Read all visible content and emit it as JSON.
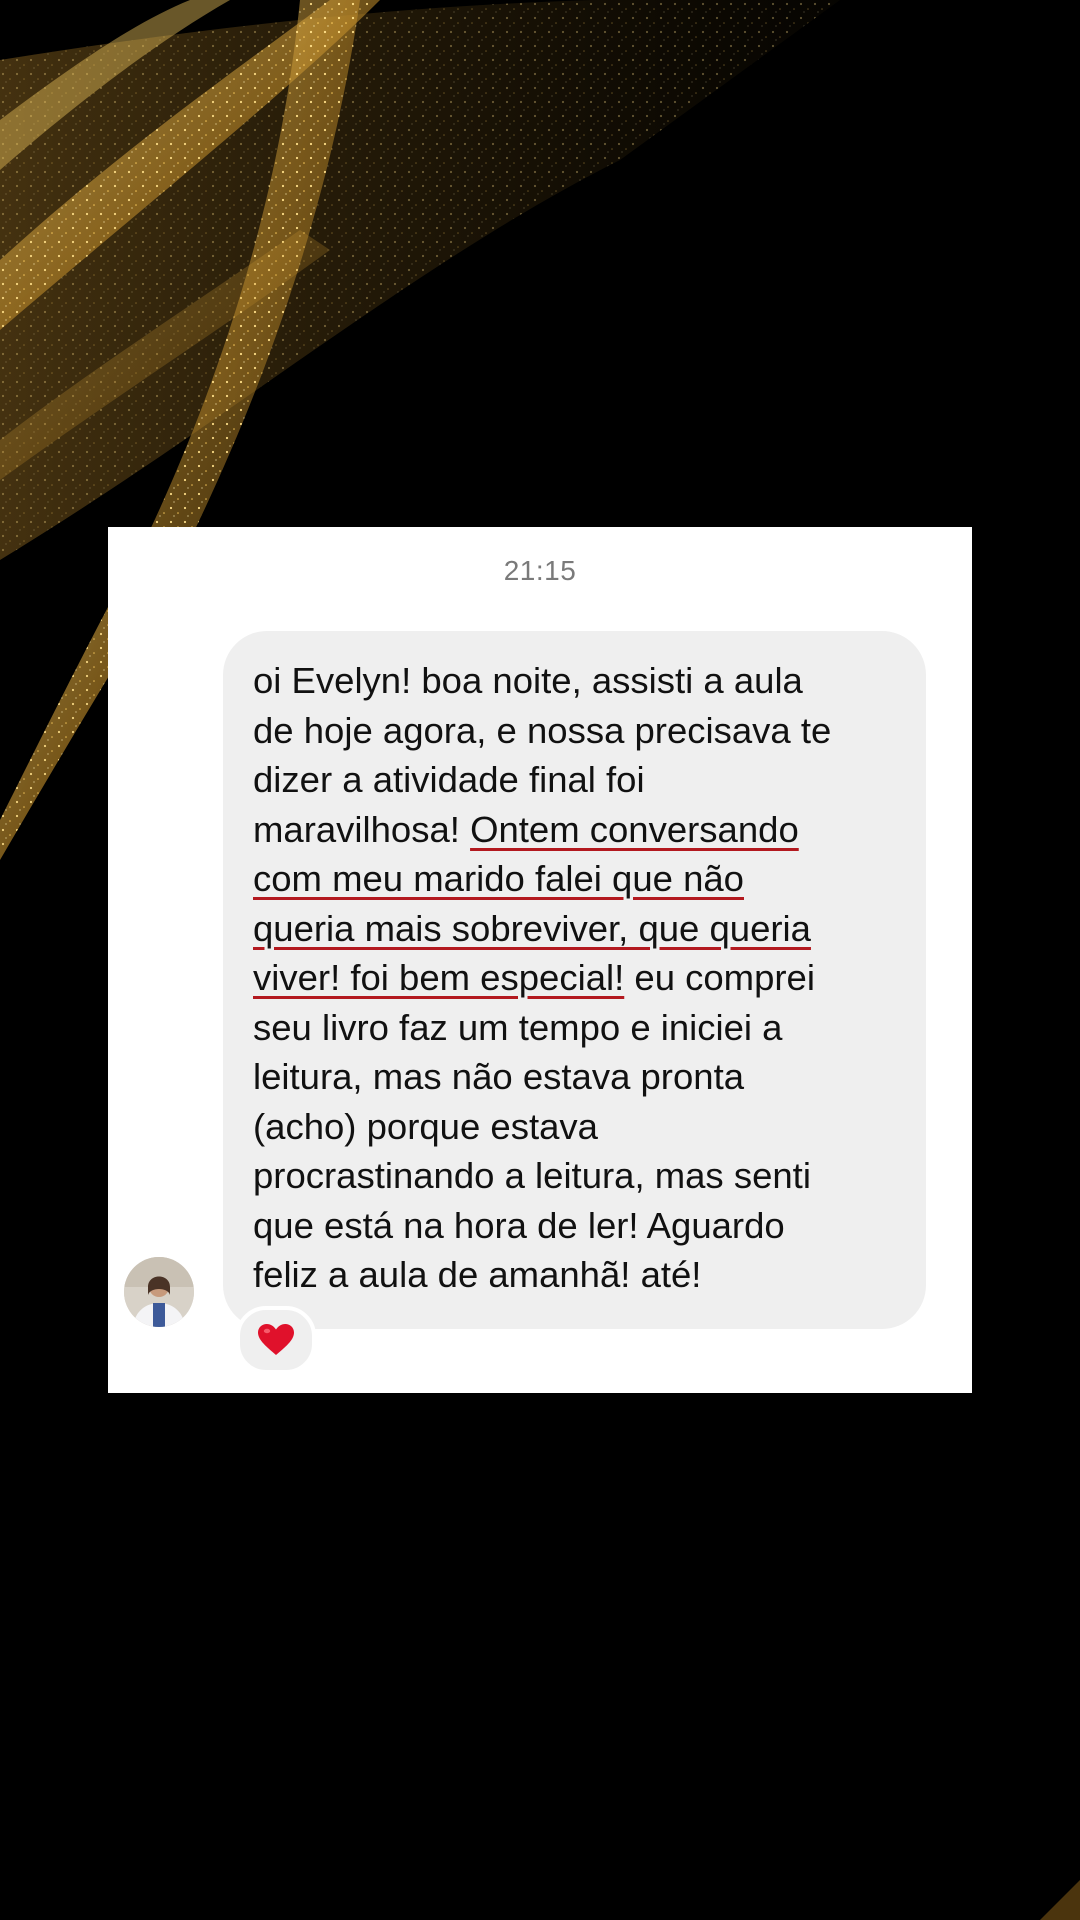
{
  "chat": {
    "timestamp": "21:15",
    "message": {
      "lines": [
        {
          "segments": [
            {
              "text": "oi Evelyn! boa noite, assisti a aula",
              "underline": false
            }
          ]
        },
        {
          "segments": [
            {
              "text": "de hoje agora, e nossa precisava te",
              "underline": false
            }
          ]
        },
        {
          "segments": [
            {
              "text": "dizer a atividade final foi",
              "underline": false
            }
          ]
        },
        {
          "segments": [
            {
              "text": "maravilhosa! ",
              "underline": false
            },
            {
              "text": "Ontem conversando",
              "underline": true
            }
          ]
        },
        {
          "segments": [
            {
              "text": "com meu marido falei que não",
              "underline": true
            }
          ]
        },
        {
          "segments": [
            {
              "text": "queria mais sobreviver, que queria",
              "underline": true
            }
          ]
        },
        {
          "segments": [
            {
              "text": "viver! foi bem especial!",
              "underline": true
            },
            {
              "text": " eu comprei",
              "underline": false
            }
          ]
        },
        {
          "segments": [
            {
              "text": "seu livro faz um tempo e iniciei a",
              "underline": false
            }
          ]
        },
        {
          "segments": [
            {
              "text": "leitura, mas não estava pronta",
              "underline": false
            }
          ]
        },
        {
          "segments": [
            {
              "text": "(acho) porque estava",
              "underline": false
            }
          ]
        },
        {
          "segments": [
            {
              "text": "procrastinando a leitura, mas senti",
              "underline": false
            }
          ]
        },
        {
          "segments": [
            {
              "text": "que está na hora de ler! Aguardo",
              "underline": false
            }
          ]
        },
        {
          "segments": [
            {
              "text": "feliz a aula de amanhã! até!",
              "underline": false
            }
          ]
        }
      ]
    },
    "reaction": {
      "icon": "heart-icon",
      "color": "#e0112b"
    },
    "sender_avatar": {
      "icon": "avatar"
    }
  },
  "theme": {
    "background": "#000000",
    "card": "#ffffff",
    "bubble": "#efefef",
    "underline": "#b3191f",
    "gold": "#d9a93a"
  }
}
